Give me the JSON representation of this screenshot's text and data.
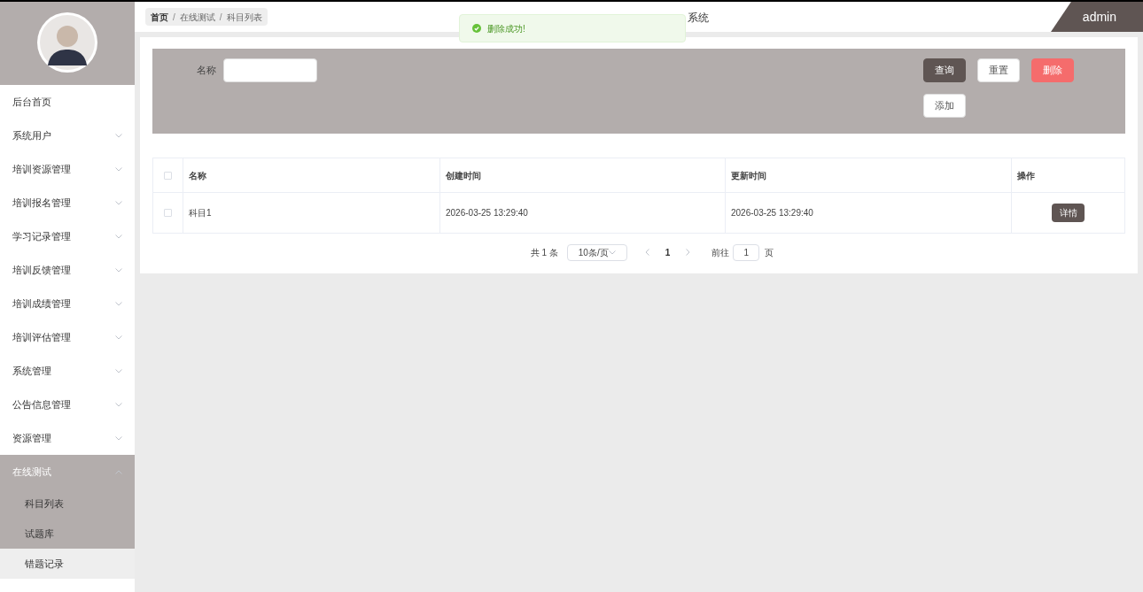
{
  "sidebar": {
    "items": [
      {
        "label": "后台首页",
        "has_children": false,
        "expanded": false
      },
      {
        "label": "系统用户",
        "has_children": true,
        "expanded": false
      },
      {
        "label": "培训资源管理",
        "has_children": true,
        "expanded": false
      },
      {
        "label": "培训报名管理",
        "has_children": true,
        "expanded": false
      },
      {
        "label": "学习记录管理",
        "has_children": true,
        "expanded": false
      },
      {
        "label": "培训反馈管理",
        "has_children": true,
        "expanded": false
      },
      {
        "label": "培训成绩管理",
        "has_children": true,
        "expanded": false
      },
      {
        "label": "培训评估管理",
        "has_children": true,
        "expanded": false
      },
      {
        "label": "系统管理",
        "has_children": true,
        "expanded": false
      },
      {
        "label": "公告信息管理",
        "has_children": true,
        "expanded": false
      },
      {
        "label": "资源管理",
        "has_children": true,
        "expanded": false
      },
      {
        "label": "在线测试",
        "has_children": true,
        "expanded": true,
        "children": [
          {
            "label": "科目列表",
            "highlighted": true
          },
          {
            "label": "试题库",
            "highlighted": true
          },
          {
            "label": "错题记录",
            "highlighted": false
          }
        ]
      }
    ]
  },
  "breadcrumb": [
    "首页",
    "在线测试",
    "科目列表"
  ],
  "breadcrumb_separator": "/",
  "title": "系统",
  "user": "admin",
  "toast": {
    "message": "删除成功!"
  },
  "search": {
    "label": "名称"
  },
  "buttons": [
    {
      "label": "查询",
      "kind": "dark"
    },
    {
      "label": "重置",
      "kind": "light"
    },
    {
      "label": "删除",
      "kind": "danger"
    },
    {
      "label": "添加",
      "kind": "light"
    }
  ],
  "table": {
    "all_checked": false,
    "columns": [
      "名称",
      "创建时间",
      "更新时间",
      "操作"
    ],
    "rows": [
      {
        "checked": false,
        "cells": [
          "科目1",
          "2026-03-25 13:29:40",
          "2026-03-25 13:29:40"
        ],
        "action": "详情"
      }
    ]
  },
  "pagination": {
    "total": "共 1 条",
    "page_size": "10条/页",
    "current": "1",
    "goto_label": "前往",
    "goto_value": "1",
    "page_unit": "页"
  }
}
